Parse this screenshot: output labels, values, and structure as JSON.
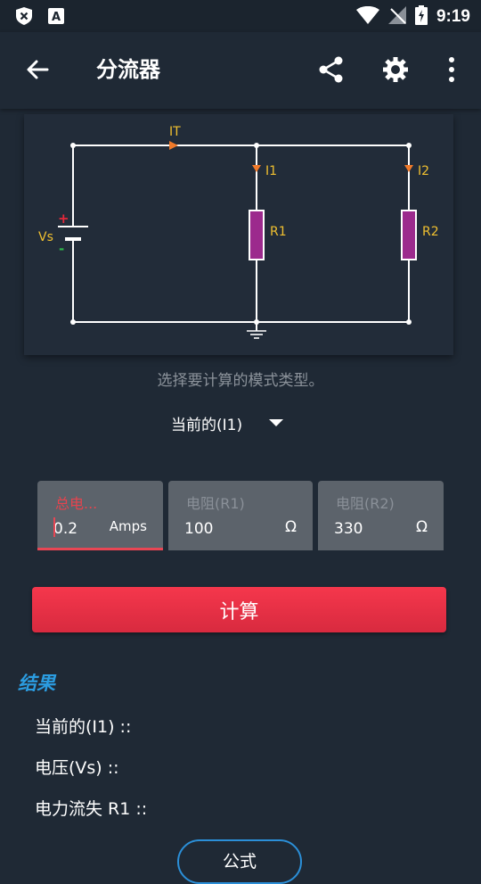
{
  "status_bar": {
    "time": "9:19"
  },
  "app_bar": {
    "title": "分流器"
  },
  "circuit": {
    "labels": {
      "it": "IT",
      "i1": "I1",
      "i2": "I2",
      "vs": "Vs",
      "r1": "R1",
      "r2": "R2",
      "plus": "+",
      "minus": "-"
    },
    "colors": {
      "wire": "#ffffff",
      "resistor": "#9c2a8d",
      "current": "#f0c030",
      "arrow": "#f07a2a",
      "plus": "#e5273a",
      "minus": "#2fb84b"
    }
  },
  "hint": "选择要计算的模式类型。",
  "mode": {
    "selected": "当前的(I1)"
  },
  "fields": [
    {
      "label": "总电...",
      "value": "0.2",
      "unit": "Amps"
    },
    {
      "label": "电阻(R1)",
      "value": "100",
      "unit": "Ω"
    },
    {
      "label": "电阻(R2)",
      "value": "330",
      "unit": "Ω"
    }
  ],
  "calculate_label": "计算",
  "results": {
    "title": "结果",
    "items": [
      "当前的(I1) ::",
      "电压(Vs) ::",
      "电力流失 R1 ::"
    ]
  },
  "formula_label": "公式",
  "colors": {
    "accent": "#e84654",
    "result_title": "#2b9ce0",
    "background": "#1f2935"
  }
}
